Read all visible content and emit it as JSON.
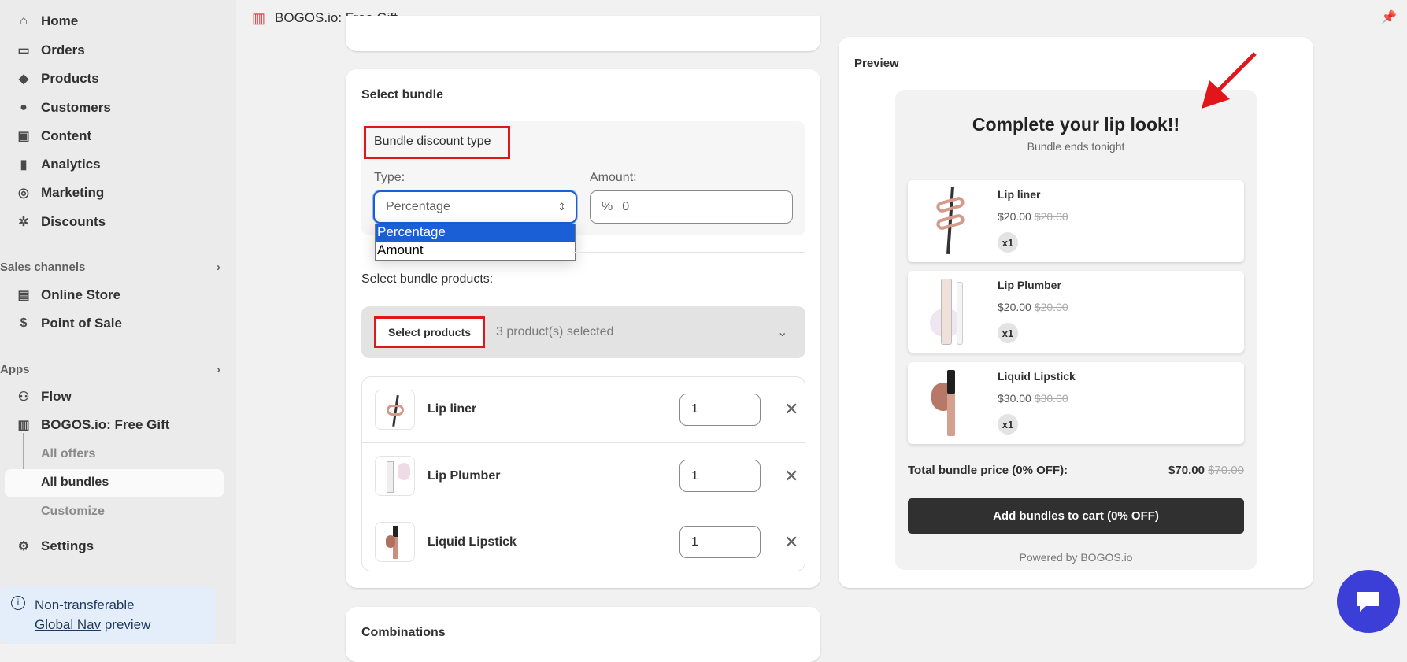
{
  "sidebar": {
    "items": [
      {
        "label": "Home",
        "icon": "home-icon"
      },
      {
        "label": "Orders",
        "icon": "inbox-icon"
      },
      {
        "label": "Products",
        "icon": "tag-icon"
      },
      {
        "label": "Customers",
        "icon": "person-icon"
      },
      {
        "label": "Content",
        "icon": "image-icon"
      },
      {
        "label": "Analytics",
        "icon": "bar-chart-icon"
      },
      {
        "label": "Marketing",
        "icon": "target-icon"
      },
      {
        "label": "Discounts",
        "icon": "discount-icon"
      }
    ],
    "sales_channels": "Sales channels",
    "channels": [
      {
        "label": "Online Store",
        "icon": "store-icon"
      },
      {
        "label": "Point of Sale",
        "icon": "pos-icon"
      }
    ],
    "apps": "Apps",
    "app_items": [
      {
        "label": "Flow",
        "icon": "flow-icon"
      },
      {
        "label": "BOGOS.io: Free Gift",
        "icon": "gift-icon"
      }
    ],
    "sub_items": [
      "All offers",
      "All bundles",
      "Customize"
    ],
    "active_sub": "All bundles",
    "settings": "Settings",
    "notice": {
      "line1": "Non-transferable",
      "link": "Global Nav",
      "rest": " preview"
    }
  },
  "topbar": {
    "title": "BOGOS.io: Free Gift",
    "icon": "gift-icon",
    "pin": "pin-icon"
  },
  "bundle": {
    "title": "Select bundle",
    "discount_type_heading": "Bundle discount type",
    "type_label": "Type:",
    "type_value": "Percentage",
    "type_options": [
      "Percentage",
      "Amount"
    ],
    "amount_label": "Amount:",
    "amount_prefix": "%",
    "amount_value": "0",
    "products_label": "Select bundle products:",
    "select_products_button": "Select products",
    "selected_count": "3 product(s) selected",
    "products": [
      {
        "name": "Lip liner",
        "qty": "1"
      },
      {
        "name": "Lip Plumber",
        "qty": "1"
      },
      {
        "name": "Liquid Lipstick",
        "qty": "1"
      }
    ]
  },
  "combinations": {
    "title": "Combinations"
  },
  "preview": {
    "label": "Preview",
    "headline": "Complete your lip look!!",
    "subheadline": "Bundle ends tonight",
    "items": [
      {
        "name": "Lip liner",
        "price": "$20.00",
        "compare": "$20.00",
        "qty": "x1"
      },
      {
        "name": "Lip Plumber",
        "price": "$20.00",
        "compare": "$20.00",
        "qty": "x1"
      },
      {
        "name": "Liquid Lipstick",
        "price": "$30.00",
        "compare": "$30.00",
        "qty": "x1"
      }
    ],
    "total_label": "Total bundle price (0% OFF):",
    "total": "$70.00",
    "total_compare": "$70.00",
    "cta": "Add bundles to cart (0% OFF)",
    "powered": "Powered by BOGOS.io"
  },
  "colors": {
    "annotation_red": "#e0161b",
    "select_blue": "#1a5fd6",
    "chat_blue": "#3b3fd8",
    "cta_dark": "#303030"
  }
}
